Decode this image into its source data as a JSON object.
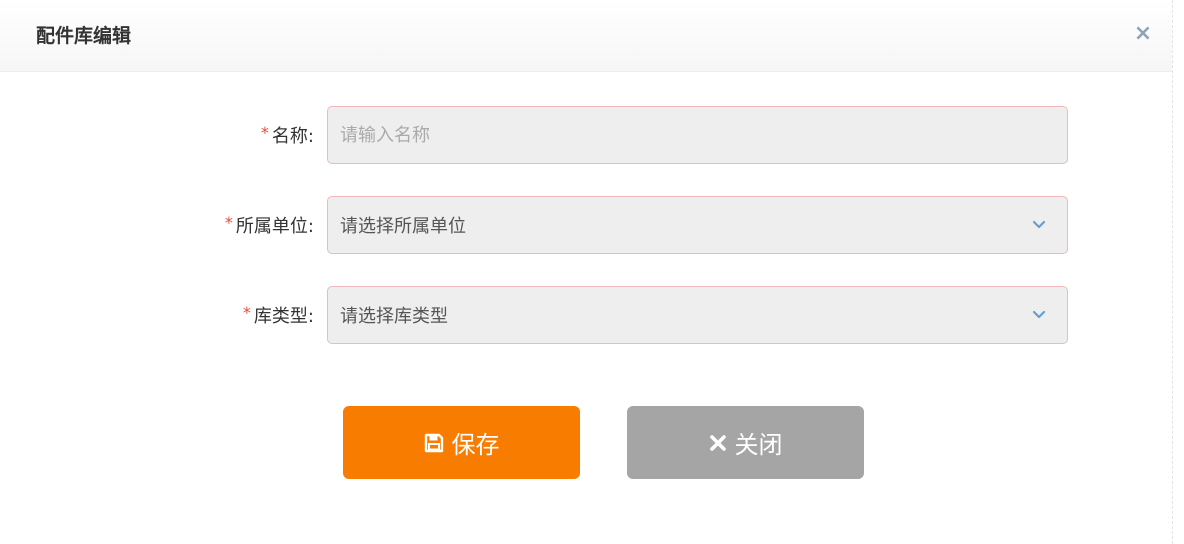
{
  "dialog": {
    "title": "配件库编辑",
    "close_glyph": "×"
  },
  "form": {
    "name": {
      "required_mark": "*",
      "label": "名称:",
      "placeholder": "请输入名称",
      "value": ""
    },
    "unit": {
      "required_mark": "*",
      "label": "所属单位:",
      "selected": "请选择所属单位",
      "icon": "chevron-down-icon"
    },
    "store_type": {
      "required_mark": "*",
      "label": "库类型:",
      "selected": "请选择库类型",
      "icon": "chevron-down-icon"
    }
  },
  "actions": {
    "save_label": "保存",
    "save_icon": "floppy-disk-icon",
    "close_label": "关闭",
    "close_icon": "close-x-icon"
  },
  "colors": {
    "primary_button": "#f77c00",
    "secondary_button": "#a5a5a5",
    "required": "#e94b3c",
    "field_border": "#f0b8bd",
    "field_bg": "#eeeeee",
    "chevron": "#6b9bd1"
  }
}
